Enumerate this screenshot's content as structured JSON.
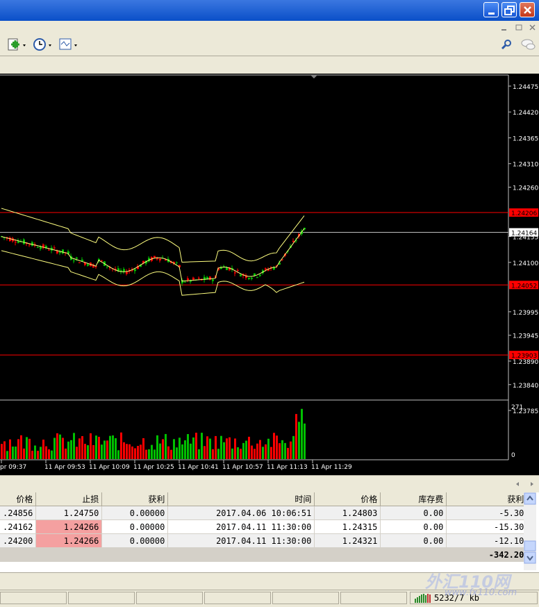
{
  "window": {
    "minimize_icon": "minimize-icon",
    "restore_icon": "restore-icon",
    "close_icon": "close-icon"
  },
  "toolbar": {
    "icons": [
      "new-chart-icon",
      "clock-icon",
      "template-icon"
    ],
    "search_icon": "search-icon",
    "chat_icon": "chat-icon"
  },
  "chart_data": {
    "type": "candlestick",
    "y_ticks": [
      "1.24475",
      "1.24420",
      "1.24365",
      "1.24310",
      "1.24260",
      "1.24155",
      "1.24100",
      "1.23995",
      "1.23945",
      "1.23890",
      "1.23840",
      "1.23785"
    ],
    "ylim": [
      1.23785,
      1.24475
    ],
    "x_ticks": [
      "pr 09:37",
      "11 Apr 09:53",
      "11 Apr 10:09",
      "11 Apr 10:25",
      "11 Apr 10:41",
      "11 Apr 10:57",
      "11 Apr 11:13",
      "11 Apr 11:29"
    ],
    "price_labels": [
      {
        "text": "1.24206",
        "value": 1.24206,
        "color": "#ff0000"
      },
      {
        "text": "1.24164",
        "value": 1.24164,
        "color": "#ffffff"
      },
      {
        "text": "1.24052",
        "value": 1.24052,
        "color": "#ff0000"
      },
      {
        "text": "1.23903",
        "value": 1.23903,
        "color": "#ff0000"
      }
    ],
    "volume_ticks": [
      "271",
      "0"
    ],
    "colors": {
      "up": "#00c000",
      "down": "#ff0000",
      "bands": "#ffff80",
      "grid": "#c0c0c0"
    }
  },
  "terminal": {
    "columns": [
      "价格",
      "止损",
      "获利",
      "时间",
      "价格",
      "库存费",
      "获利"
    ],
    "rows": [
      [
        ".24856",
        "1.24750",
        "0.00000",
        "2017.04.06 10:06:51",
        "1.24803",
        "0.00",
        "-5.30"
      ],
      [
        ".24162",
        "1.24266",
        "0.00000",
        "2017.04.11 11:30:00",
        "1.24315",
        "0.00",
        "-15.30"
      ],
      [
        ".24200",
        "1.24266",
        "0.00000",
        "2017.04.11 11:30:00",
        "1.24321",
        "0.00",
        "-12.10"
      ]
    ],
    "total": "-342.20"
  },
  "statusbar": {
    "traffic": "5232/7 kb"
  },
  "watermark": {
    "main": "外汇110网",
    "sub": "www.fx110.com"
  }
}
